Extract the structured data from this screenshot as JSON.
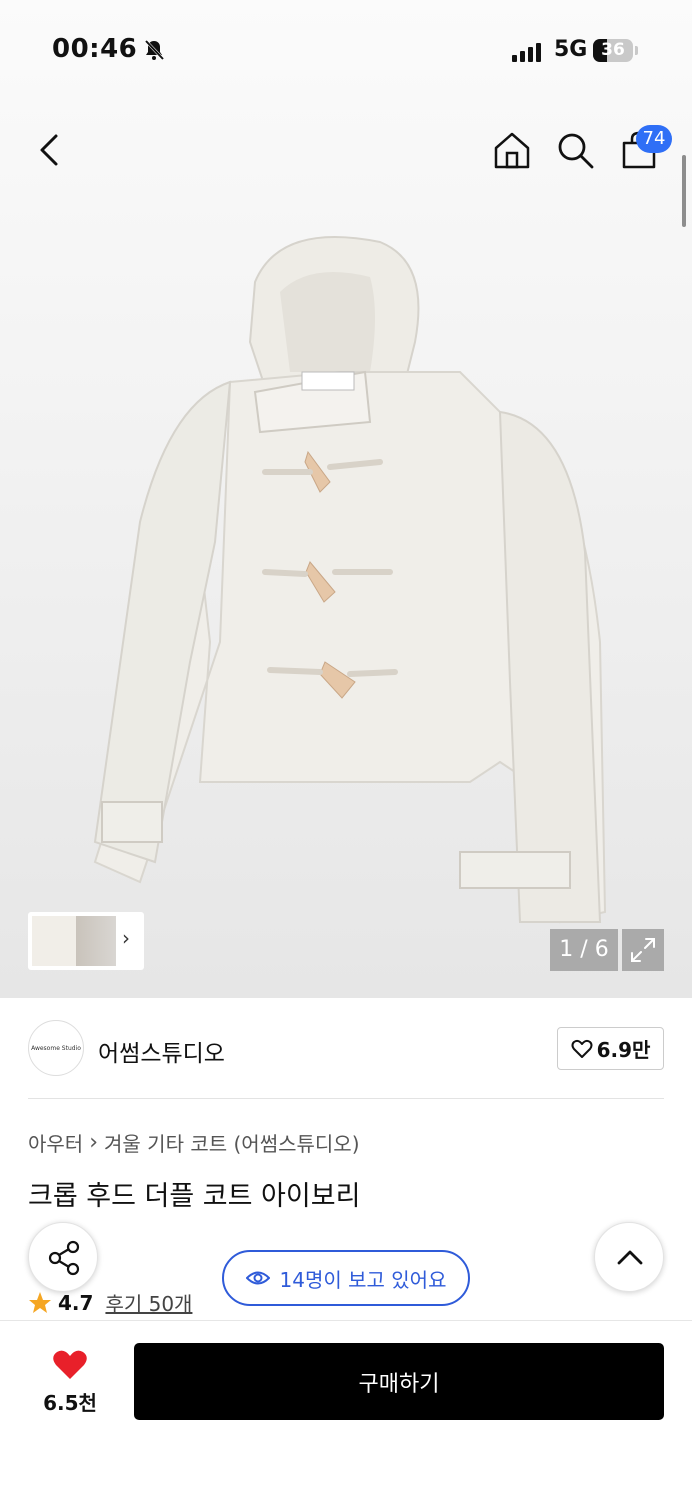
{
  "status_bar": {
    "time": "00:46",
    "network": "5G",
    "battery": "36"
  },
  "header": {
    "cart_count": "74"
  },
  "gallery": {
    "pager": "1 / 6"
  },
  "brand": {
    "logo_text": "Awesome Studio",
    "name": "어썸스튜디오",
    "follow_count": "6.9만"
  },
  "breadcrumb": {
    "category": "아우터",
    "subcategory": "겨울 기타 코트 (어썸스튜디오)"
  },
  "product": {
    "title": "크롭 후드 더플 코트 아이보리"
  },
  "rating": {
    "score": "4.7",
    "reviews": "후기 50개"
  },
  "live": {
    "viewers": "14명이 보고 있어요"
  },
  "bottom": {
    "like_count": "6.5천",
    "buy_label": "구매하기"
  },
  "colors": {
    "accent": "#2f6ff6",
    "viewer_blue": "#2f5bd9",
    "heart": "#e8202a",
    "star": "#f5a623"
  },
  "icons": [
    "back-icon",
    "home-icon",
    "search-icon",
    "shopping-bag-icon",
    "expand-icon",
    "share-icon",
    "chevron-up-icon",
    "eye-icon",
    "heart-icon",
    "star-icon",
    "chevron-right-icon",
    "bell-slash-icon"
  ]
}
